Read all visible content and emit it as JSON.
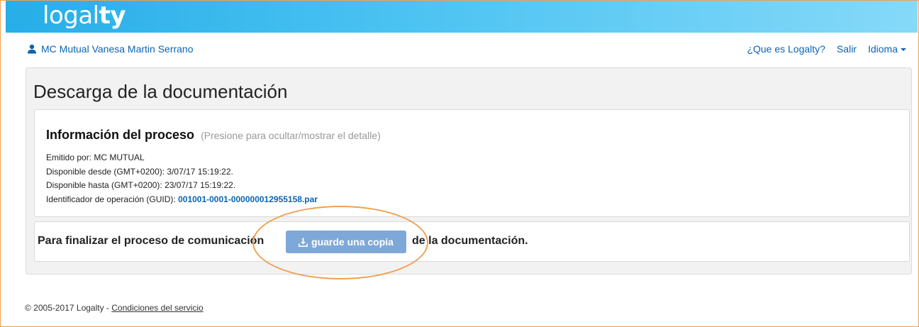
{
  "brand": {
    "logo_light": "logal",
    "logo_bold": "ty"
  },
  "user": {
    "name": "MC Mutual Vanesa Martin Serrano"
  },
  "topnav": {
    "about": "¿Que es Logalty?",
    "logout": "Salir",
    "language": "Idioma"
  },
  "page": {
    "title": "Descarga de la documentación"
  },
  "info": {
    "title": "Información del proceso",
    "hint": "(Presione para ocultar/mostrar el detalle)",
    "issued_by": "Emitido por: MC MUTUAL",
    "available_from": "Disponible desde (GMT+0200): 3/07/17 15:19:22.",
    "available_until": "Disponible hasta (GMT+0200): 23/07/17 15:19:22.",
    "guid_label": "Identificador de operación (GUID): ",
    "guid_value": "001001-0001-000000012955158.par"
  },
  "action": {
    "text_before": "Para finalizar el proceso de comunicación",
    "button_label": "guarde una copia",
    "text_after": "de la documentación."
  },
  "footer": {
    "copyright": "© 2005-2017 Logalty - ",
    "terms_link": "Condiciones del servicio"
  },
  "colors": {
    "header_start": "#27aee8",
    "header_end": "#86d9f8",
    "link": "#0a64b4",
    "button": "#7ea8d8",
    "highlight": "#f0a050"
  },
  "icons": {
    "user": "user-icon",
    "language_caret": "caret-down-icon",
    "download": "download-icon"
  }
}
